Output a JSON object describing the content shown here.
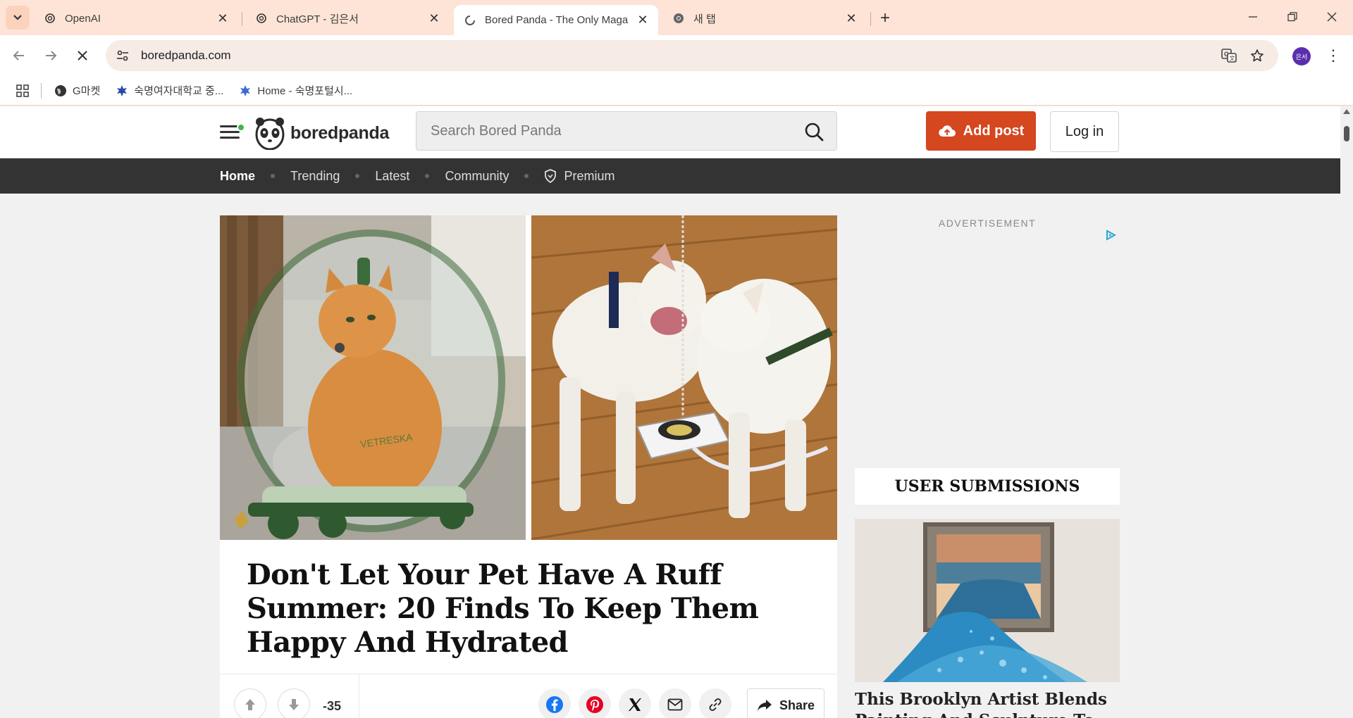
{
  "browser": {
    "tabs": [
      {
        "title": "OpenAI",
        "active": false
      },
      {
        "title": "ChatGPT - 김은서",
        "active": false
      },
      {
        "title": "Bored Panda - The Only Maga",
        "active": true
      },
      {
        "title": "새 탭",
        "active": false
      }
    ],
    "url": "boredpanda.com",
    "profile_initials": "은서",
    "bookmarks": [
      {
        "label": "G마켓",
        "icon": "globe-icon"
      },
      {
        "label": "숙명여자대학교 중...",
        "icon": "snowflake-icon"
      },
      {
        "label": "Home - 숙명포털시...",
        "icon": "snowflake-icon"
      }
    ]
  },
  "site": {
    "logo_text": "boredpanda",
    "search_placeholder": "Search Bored Panda",
    "add_post_label": "Add post",
    "login_label": "Log in",
    "nav": [
      "Home",
      "Trending",
      "Latest",
      "Community",
      "Premium"
    ],
    "active_nav": "Home"
  },
  "article": {
    "title": "Don't Let Your Pet Have A Ruff Summer: 20 Finds To Keep Them Happy And Hydrated",
    "vote_count": "-35",
    "share_label": "Share",
    "image_left_text": "VETRESKA"
  },
  "sidebar": {
    "ad_label": "ADVERTISEMENT",
    "submissions_heading": "USER SUBMISSIONS",
    "submission_title": "This Brooklyn Artist Blends Painting And Sculpture To Create"
  },
  "colors": {
    "chrome_frame": "#fde4d6",
    "site_nav_bg": "#333333",
    "add_post_bg": "#d4471f",
    "profile_bg": "#5a2fae"
  }
}
